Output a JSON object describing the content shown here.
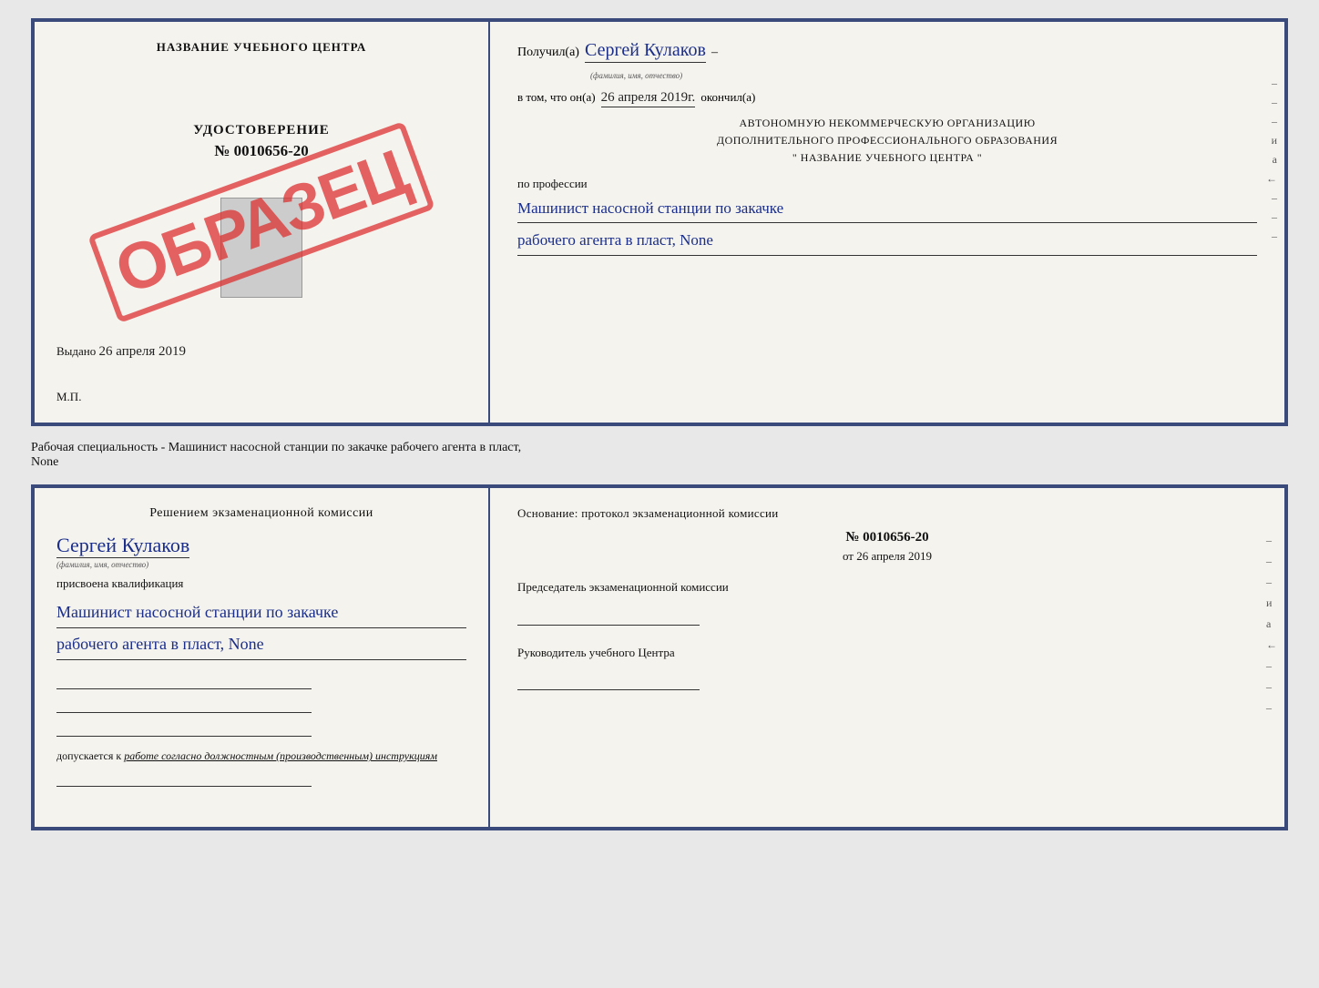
{
  "top_doc": {
    "left": {
      "center_title": "НАЗВАНИЕ УЧЕБНОГО ЦЕНТРА",
      "udostoverenie_title": "УДОСТОВЕРЕНИЕ",
      "udostoverenie_num": "№ 0010656-20",
      "stamp": "ОБРАЗЕЦ",
      "vydano_label": "Выдано",
      "vydano_date": "26 апреля 2019",
      "mp_label": "М.П."
    },
    "right": {
      "poluchil_label": "Получил(а)",
      "poluchil_name": "Сергей Кулаков",
      "poluchil_sub": "(фамилия, имя, отчество)",
      "dash1": "–",
      "vtom_label": "в том, что он(а)",
      "vtom_date": "26 апреля 2019г.",
      "okonchil_label": "окончил(а)",
      "org_line1": "АВТОНОМНУЮ НЕКОММЕРЧЕСКУЮ ОРГАНИЗАЦИЮ",
      "org_line2": "ДОПОЛНИТЕЛЬНОГО ПРОФЕССИОНАЛЬНОГО ОБРАЗОВАНИЯ",
      "org_line3": "\"  НАЗВАНИЕ УЧЕБНОГО ЦЕНТРА  \"",
      "po_professii": "по профессии",
      "profession1": "Машинист насосной станции по закачке",
      "profession2": "рабочего агента в пласт, None",
      "dashes": [
        "–",
        "–",
        "и",
        "а",
        "←",
        "–",
        "–",
        "–"
      ]
    }
  },
  "middle": {
    "text": "Рабочая специальность - Машинист насосной станции по закачке рабочего агента в пласт,",
    "text2": "None"
  },
  "bottom_doc": {
    "left": {
      "resheniem": "Решением экзаменационной комиссии",
      "name_hand": "Сергей Кулаков",
      "fio_sub": "(фамилия, имя, отчество)",
      "prisvoyena": "присвоена квалификация",
      "kvalif1": "Машинист насосной станции по закачке",
      "kvalif2": "рабочего агента в пласт, None",
      "dopusk_label": "допускается к",
      "dopusk_italic": "работе согласно должностным (производственным) инструкциям"
    },
    "right": {
      "osnovanie": "Основание: протокол экзаменационной комиссии",
      "protokol_num": "№ 0010656-20",
      "protokol_ot": "от",
      "protokol_date": "26 апреля 2019",
      "predsedatel_label": "Председатель экзаменационной комиссии",
      "rukovoditel_label": "Руководитель учебного Центра",
      "dashes": [
        "–",
        "–",
        "–",
        "и",
        "а",
        "←",
        "–",
        "–",
        "–"
      ]
    }
  }
}
